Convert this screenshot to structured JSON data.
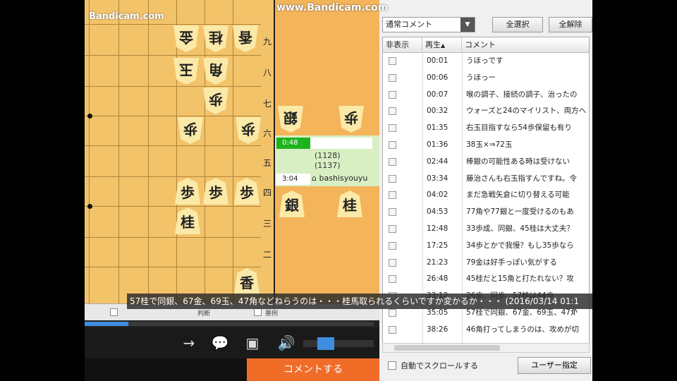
{
  "watermark": "www.Bandicam.com",
  "player": {
    "bandicam_small": "Bandicam.com",
    "ranks": [
      "九",
      "八",
      "七",
      "六",
      "五",
      "四",
      "三",
      "二"
    ],
    "board_pieces_opponent": [
      "香",
      "桂",
      "金",
      "玉",
      "角",
      "歩",
      "歩",
      "歩"
    ],
    "board_pieces_player": [
      "歩",
      "歩",
      "歩",
      "桂",
      "香"
    ],
    "hand_opponent": [
      "銀",
      "歩"
    ],
    "hand_player": [
      "銀",
      "桂"
    ],
    "timer1": "0:48",
    "rating1": "(1128)",
    "rating2": "(1137)",
    "timer2": "3:04",
    "opponent_name": "bashisyouyu",
    "strip_labels": [
      "",
      "判断",
      "悪例"
    ],
    "caption": "57桂で同銀、67金、69玉、47角などねらうのは・・・桂馬取られるくらいですか変かるか・・・ (2016/03/14 01:1",
    "seek_progress": 0.15,
    "volume_level": 0.2,
    "comment_button": "コメントする"
  },
  "panel": {
    "filter_value": "通常コメント",
    "select_all": "全選択",
    "deselect_all": "全解除",
    "columns": [
      "非表示",
      "再生",
      "コメント"
    ],
    "sort_indicator": "▲",
    "rows": [
      {
        "time": "00:01",
        "text": "うほっです"
      },
      {
        "time": "00:06",
        "text": "うほっー"
      },
      {
        "time": "00:07",
        "text": "喉の調子、接続の調子、治ったの"
      },
      {
        "time": "00:32",
        "text": "ウォーズと24のマイリスト、両方へ"
      },
      {
        "time": "01:35",
        "text": "右玉目指すなら54歩保留も有り"
      },
      {
        "time": "01:36",
        "text": "38玉×⇒72玉"
      },
      {
        "time": "02:44",
        "text": "棒銀の可能性ある時は受けない"
      },
      {
        "time": "03:34",
        "text": "藤治さんも右玉指すんですね。令"
      },
      {
        "time": "04:02",
        "text": "まだ急戦矢倉に切り替える可能"
      },
      {
        "time": "04:53",
        "text": "77角や77銀と一度受けるのもあ"
      },
      {
        "time": "12:48",
        "text": "33歩成、同銀、45桂は大丈夫？"
      },
      {
        "time": "17:25",
        "text": "34歩とかで我慢？もし35歩なら"
      },
      {
        "time": "21:23",
        "text": "79金は好手っぽい気がする"
      },
      {
        "time": "26:48",
        "text": "45桂だと15角と打たれない？攻"
      },
      {
        "time": "33:12",
        "text": "26歩、同歩、57桂は44歩"
      },
      {
        "time": "35:05",
        "text": "57桂で同銀、67金、69玉、47角"
      },
      {
        "time": "38:26",
        "text": "46角打ってしまうのは、攻めが切"
      }
    ],
    "auto_scroll_label": "自動でスクロールする",
    "user_button": "ユーザー指定"
  },
  "colors": {
    "board": "#f3c36a",
    "accent_orange": "#f06d28",
    "accent_blue": "#3d8ee0",
    "timer_green": "#1db31d"
  }
}
